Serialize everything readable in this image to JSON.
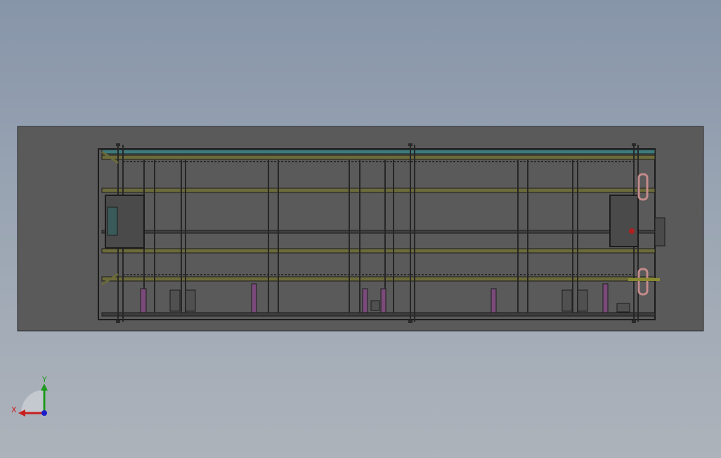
{
  "viewport": {
    "background_top": "#8795a9",
    "background_bottom": "#adb3bb"
  },
  "model": {
    "view_rect_color": "#5a5a5a",
    "frame_color": "#1c1c1c",
    "rail_olive": "#6b6a3a",
    "rail_teal": "#3e7a7c",
    "support_purple": "#7a4a7a",
    "handle_pink": "#c48a8a"
  },
  "triad": {
    "x_label": "X",
    "y_label": "Y",
    "x_color": "#c81e1e",
    "y_color": "#1e9a1e",
    "z_color": "#1e1ec8"
  }
}
